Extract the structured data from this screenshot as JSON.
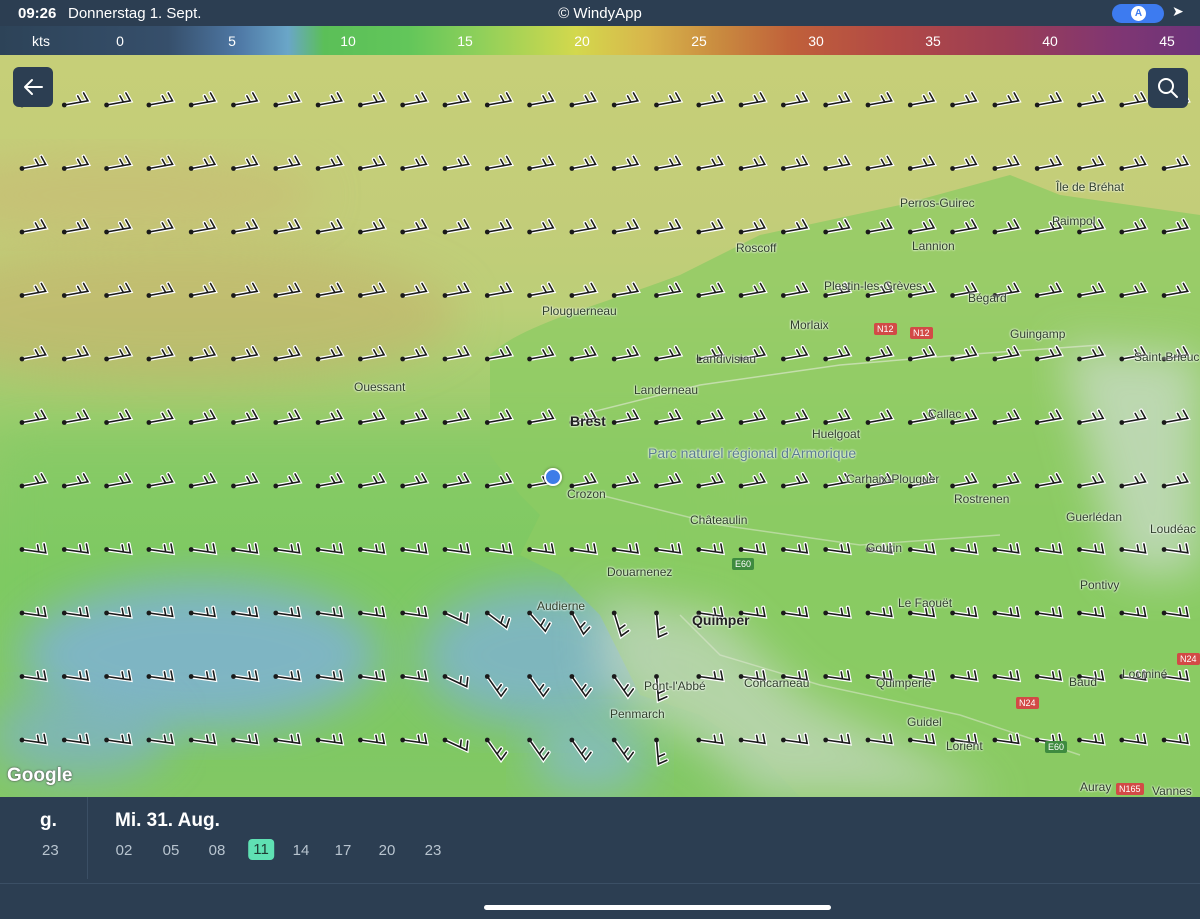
{
  "status": {
    "time": "09:26",
    "date": "Donnerstag 1. Sept.",
    "title": "© WindyApp",
    "nav_letter": "A",
    "location_icon": "location-arrow-icon"
  },
  "legend": {
    "unit": "kts",
    "ticks": [
      "0",
      "5",
      "10",
      "15",
      "20",
      "25",
      "30",
      "35",
      "40",
      "45"
    ],
    "colors": [
      "#2d4358",
      "#6aa6c8",
      "#5bbf58",
      "#d3d84d",
      "#c98a3f",
      "#b24a45",
      "#6c3479"
    ]
  },
  "map": {
    "back_icon": "arrow-left-icon",
    "search_icon": "search-icon",
    "attribution": "Google",
    "places": [
      {
        "name": "Île de Bréhat",
        "style": "normal"
      },
      {
        "name": "Perros-Guirec",
        "style": "normal"
      },
      {
        "name": "Paimpol",
        "style": "normal"
      },
      {
        "name": "Roscoff",
        "style": "normal"
      },
      {
        "name": "Lannion",
        "style": "normal"
      },
      {
        "name": "Plestin-les-Grèves",
        "style": "normal"
      },
      {
        "name": "Bégard",
        "style": "normal"
      },
      {
        "name": "Plouguerneau",
        "style": "normal"
      },
      {
        "name": "Morlaix",
        "style": "normal"
      },
      {
        "name": "Guingamp",
        "style": "normal"
      },
      {
        "name": "Landivisiau",
        "style": "normal"
      },
      {
        "name": "Saint-Brieuc",
        "style": "normal"
      },
      {
        "name": "Ouessant",
        "style": "normal"
      },
      {
        "name": "Landerneau",
        "style": "normal"
      },
      {
        "name": "Brest",
        "style": "big"
      },
      {
        "name": "Callac",
        "style": "normal"
      },
      {
        "name": "Huelgoat",
        "style": "normal"
      },
      {
        "name": "Parc naturel régional d'Armorique",
        "style": "park"
      },
      {
        "name": "Crozon",
        "style": "normal"
      },
      {
        "name": "Carhaix-Plouguer",
        "style": "normal"
      },
      {
        "name": "Rostrenen",
        "style": "normal"
      },
      {
        "name": "Châteaulin",
        "style": "normal"
      },
      {
        "name": "Guerlédan",
        "style": "normal"
      },
      {
        "name": "Loudéac",
        "style": "normal"
      },
      {
        "name": "Gourin",
        "style": "normal"
      },
      {
        "name": "Douarnenez",
        "style": "normal"
      },
      {
        "name": "Pontivy",
        "style": "normal"
      },
      {
        "name": "Audierne",
        "style": "normal"
      },
      {
        "name": "Le Faouët",
        "style": "normal"
      },
      {
        "name": "Quimper",
        "style": "big"
      },
      {
        "name": "Locminé",
        "style": "normal"
      },
      {
        "name": "Pont-l'Abbé",
        "style": "normal"
      },
      {
        "name": "Concarneau",
        "style": "normal"
      },
      {
        "name": "Quimperlé",
        "style": "normal"
      },
      {
        "name": "Baud",
        "style": "normal"
      },
      {
        "name": "Penmarch",
        "style": "normal"
      },
      {
        "name": "Guidel",
        "style": "normal"
      },
      {
        "name": "Lorient",
        "style": "normal"
      },
      {
        "name": "Auray",
        "style": "normal"
      },
      {
        "name": "Vannes",
        "style": "normal"
      }
    ],
    "roads": [
      "N12",
      "N12",
      "E60",
      "N24",
      "N24",
      "E60",
      "N165"
    ]
  },
  "timeline": {
    "prev_day": "g.",
    "prev_hour": "23",
    "day": "Mi. 31. Aug.",
    "hours": [
      "02",
      "05",
      "08",
      "11",
      "14",
      "17",
      "20",
      "23"
    ],
    "selected_hour": "11"
  }
}
